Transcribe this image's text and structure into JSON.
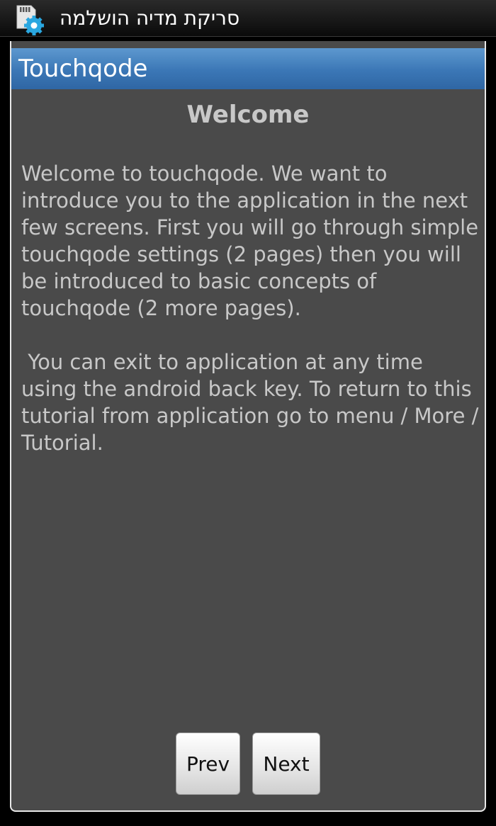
{
  "status_bar": {
    "title": "סריקת מדיה הושלמה",
    "icon": "sd-card-settings-icon"
  },
  "dialog": {
    "title": "Touchqode",
    "heading": "Welcome",
    "paragraph_1": "Welcome to touchqode. We want to introduce you to the application in the next few screens. First you will go through simple touchqode settings (2 pages) then you will be introduced to basic concepts of touchqode (2 more pages).",
    "paragraph_2": " You can exit to application at any time using the android back key. To return to this tutorial from application go to menu / More / Tutorial.",
    "prev_label": "Prev",
    "next_label": "Next"
  },
  "colors": {
    "title_bar": "#3b77b6",
    "dialog_bg": "#4a4a4a",
    "text": "#c8c8c8",
    "gear_accent": "#2aa7e0"
  }
}
